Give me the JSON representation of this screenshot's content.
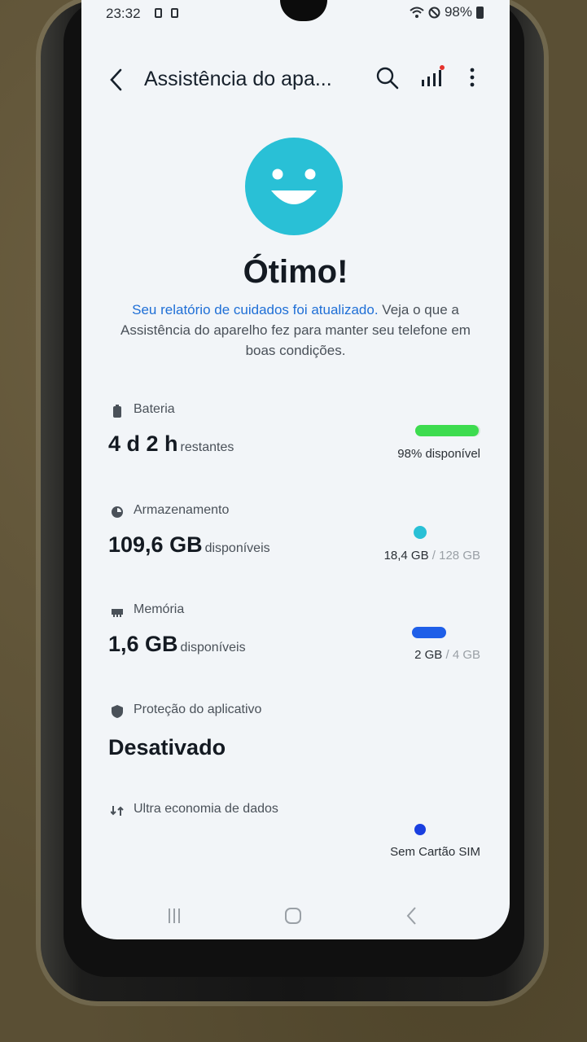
{
  "status_bar": {
    "time": "23:32",
    "battery": "98%"
  },
  "app_bar": {
    "title": "Assistência do apa..."
  },
  "hero": {
    "headline": "Ótimo!",
    "desc_link": "Seu relatório de cuidados foi atualizado.",
    "desc_rest": " Veja o que a Assistência do aparelho fez para manter seu telefone em boas condições."
  },
  "battery": {
    "label": "Bateria",
    "value": "4 d 2 h",
    "unit": "restantes",
    "right": "98% disponível",
    "available_fraction": 0.98,
    "color": "#3ddc4f"
  },
  "storage": {
    "label": "Armazenamento",
    "value": "109,6 GB",
    "unit": "disponíveis",
    "used": "18,4 GB",
    "sep": " / ",
    "total": "128 GB",
    "color": "#29c0d6"
  },
  "memory": {
    "label": "Memória",
    "value": "1,6 GB",
    "unit": "disponíveis",
    "used": "2 GB",
    "sep": " / ",
    "total": "4 GB",
    "color": "#1f5fe8"
  },
  "app_protection": {
    "label": "Proteção do aplicativo",
    "value": "Desativado"
  },
  "ultra_data": {
    "label": "Ultra economia de dados",
    "right": "Sem Cartão SIM",
    "color": "#1a3fe0"
  },
  "colors": {
    "accent": "#29c0d6",
    "link": "#1f6fd6"
  }
}
